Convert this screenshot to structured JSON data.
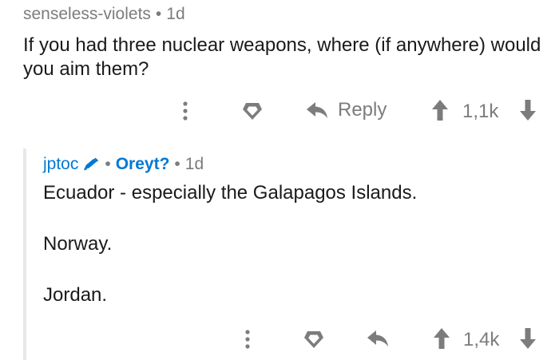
{
  "parent": {
    "author": "senseless-violets",
    "separator": "•",
    "age": "1d",
    "body": "If you had three nuclear weapons, where (if anywhere) would you aim them?",
    "actions": {
      "reply_label": "Reply",
      "score": "1,1k"
    }
  },
  "reply": {
    "author": "jptoc",
    "separator": "•",
    "flair": "Oreyt?",
    "age": "1d",
    "lines": [
      "Ecuador - especially the Galapagos Islands.",
      "Norway.",
      "Jordan."
    ],
    "actions": {
      "score": "1,4k"
    }
  },
  "icons": {
    "more": "vertical-dots-icon",
    "award": "award-icon",
    "reply": "reply-arrow-icon",
    "upvote": "upvote-arrow-icon",
    "downvote": "downvote-arrow-icon",
    "flair": "pencil-icon"
  },
  "colors": {
    "link": "#0079d3",
    "meta": "#7c7c7c",
    "text": "#1a1a1b",
    "thread": "#e8e8e8"
  }
}
